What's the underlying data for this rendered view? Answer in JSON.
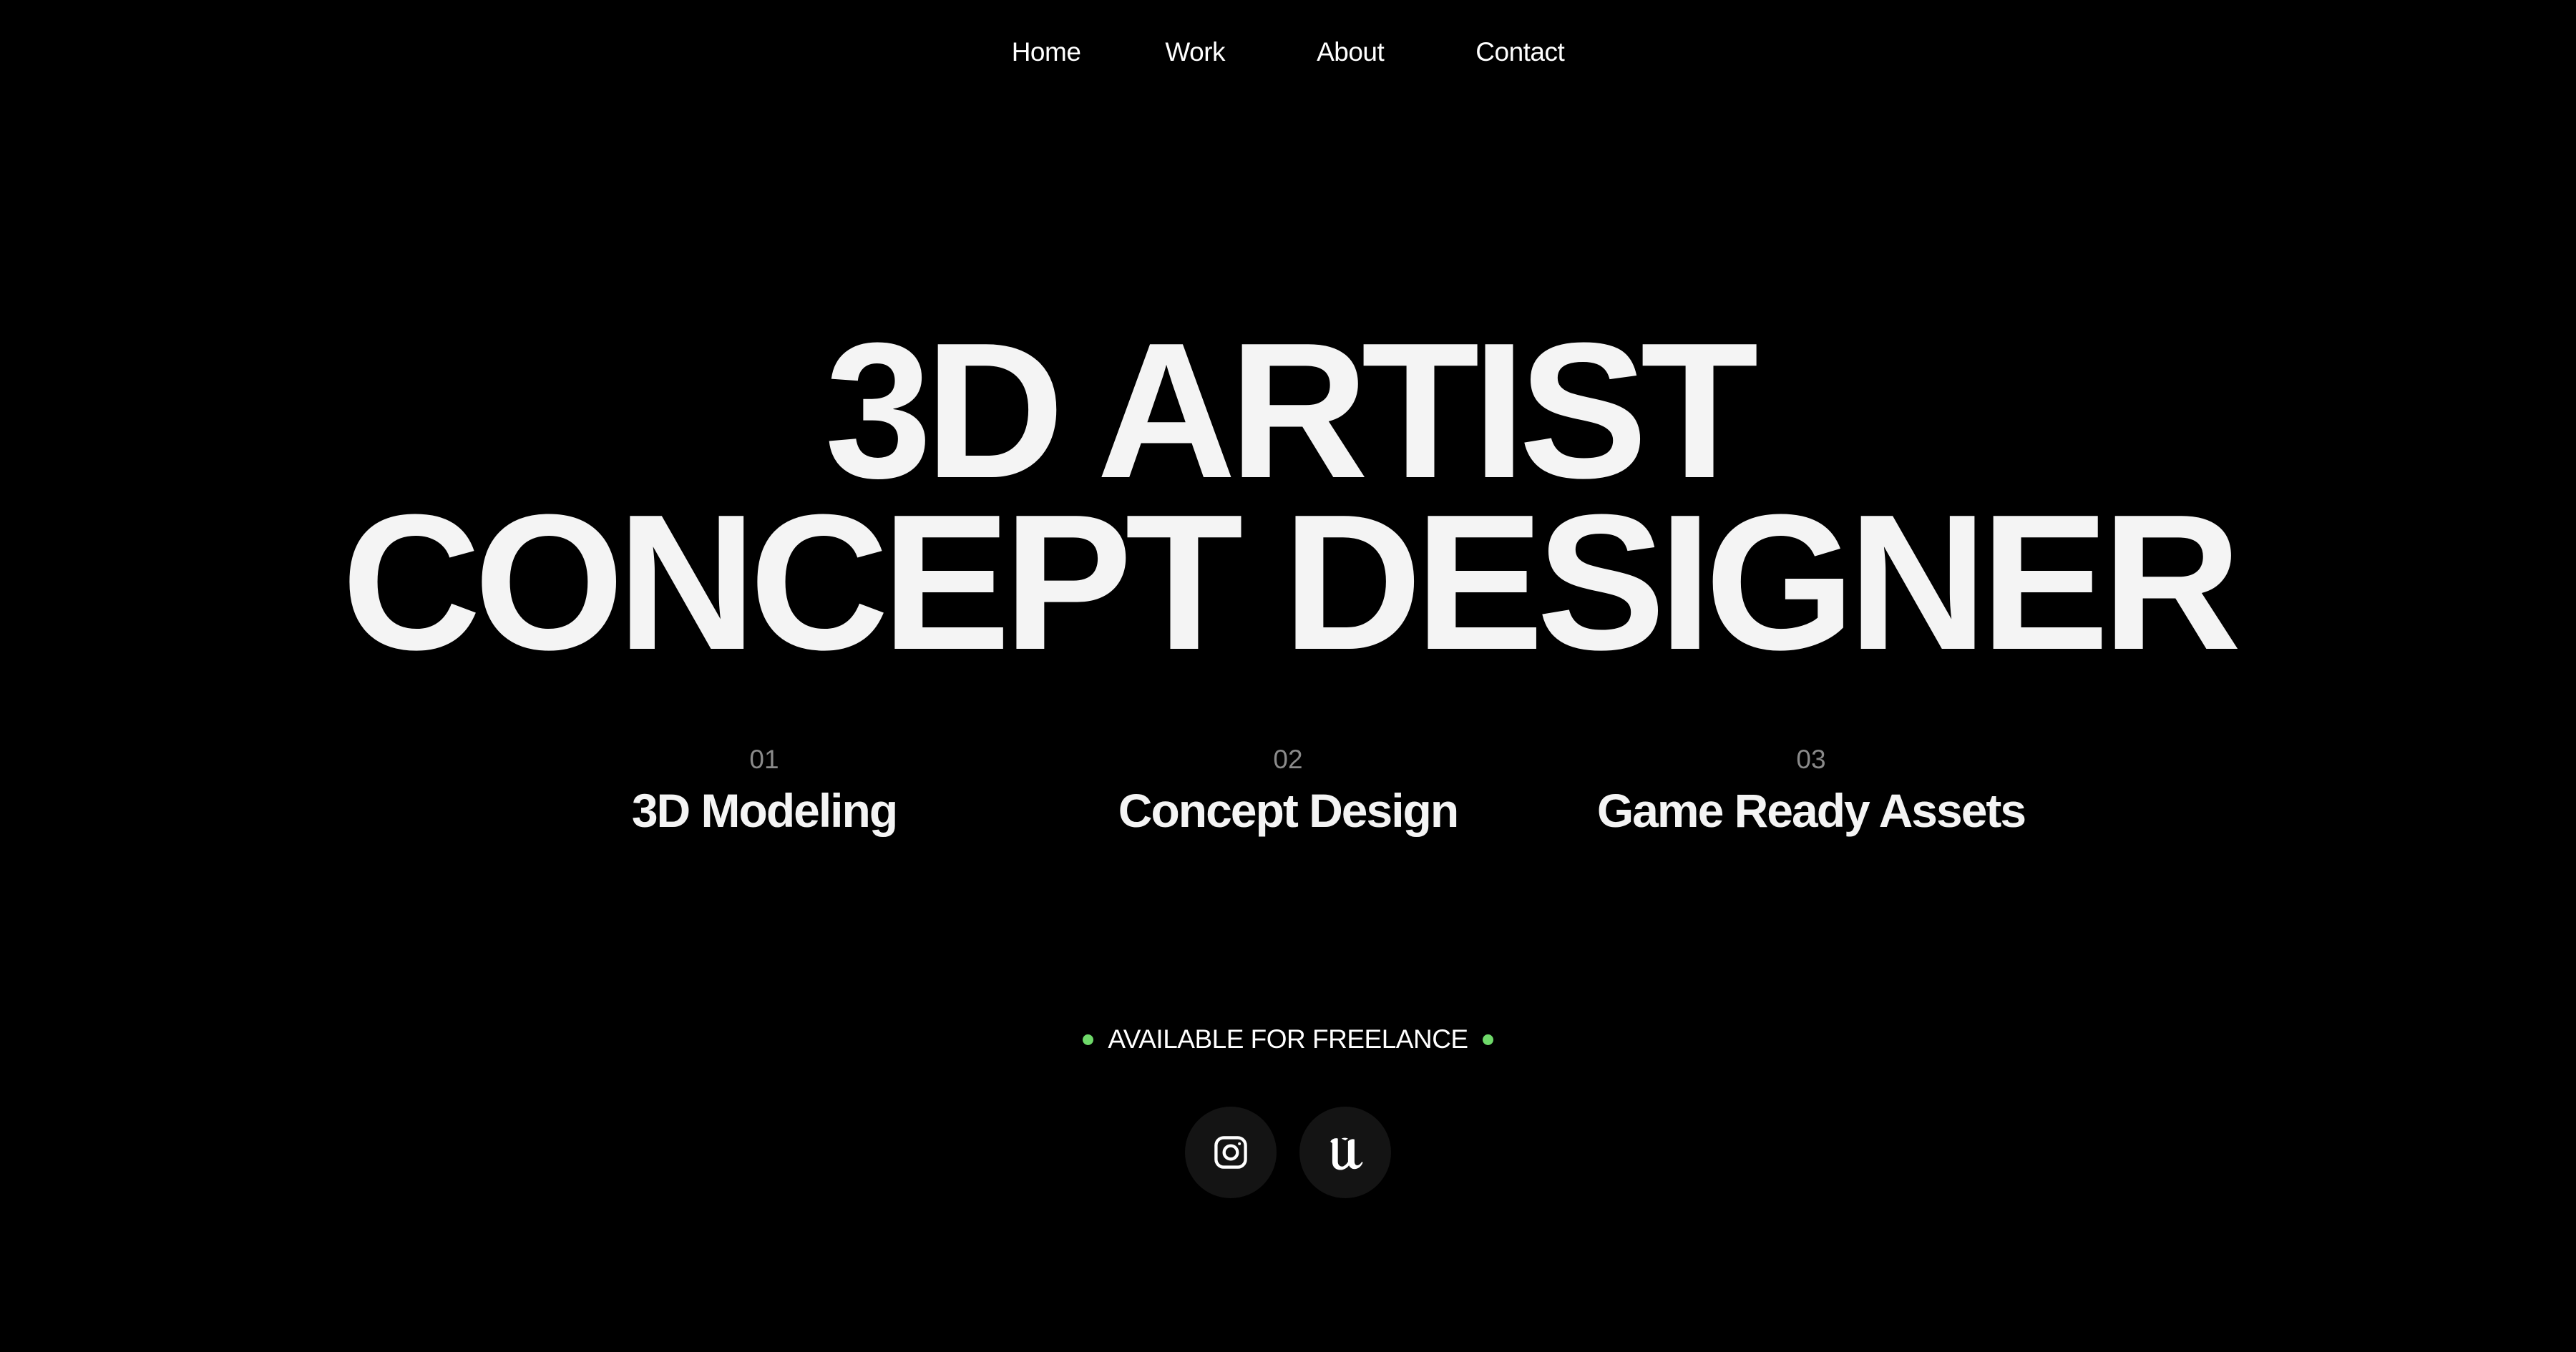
{
  "nav": {
    "items": [
      {
        "label": "Home"
      },
      {
        "label": "Work"
      },
      {
        "label": "About"
      },
      {
        "label": "Contact"
      }
    ]
  },
  "hero": {
    "line1": "3D ARTIST",
    "line2": "CONCEPT DESIGNER"
  },
  "services": [
    {
      "number": "01",
      "title": "3D Modeling"
    },
    {
      "number": "02",
      "title": "Concept Design"
    },
    {
      "number": "03",
      "title": "Game Ready Assets"
    }
  ],
  "status": {
    "label": "AVAILABLE FOR FREELANCE",
    "dot_color": "#6fd96a"
  },
  "socials": [
    {
      "icon": "instagram-icon"
    },
    {
      "icon": "unreal-engine-icon"
    }
  ],
  "colors": {
    "background": "#000000",
    "text": "#f4f4f4",
    "muted": "#8a8a8a",
    "button_bg": "#141414",
    "accent": "#6fd96a"
  }
}
